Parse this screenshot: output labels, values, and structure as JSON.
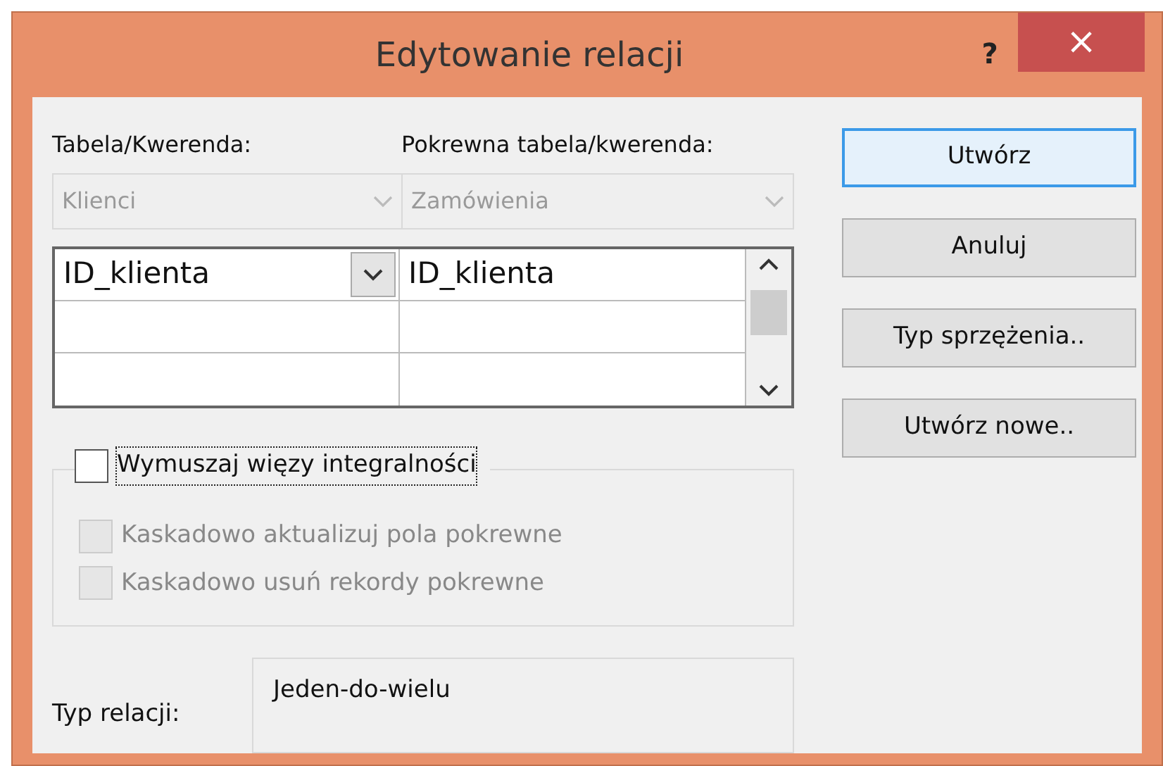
{
  "window": {
    "title": "Edytowanie relacji",
    "help": "?",
    "close": "×"
  },
  "table_label": "Tabela/Kwerenda:",
  "related_label": "Pokrewna tabela/kwerenda:",
  "table_select": {
    "value": "Klienci",
    "disabled": true
  },
  "related_select": {
    "value": "Zamówienia",
    "disabled": true
  },
  "field_rows": [
    {
      "column_1": "ID_klienta",
      "column_2": "ID_klienta"
    }
  ],
  "checkboxes": [
    {
      "label": "Wymuszaj więzy integralności",
      "checked": false,
      "disabled": false,
      "focused": true
    },
    {
      "label": "Kaskadowo aktualizuj pola pokrewne",
      "checked": false,
      "disabled": true,
      "focused": false
    },
    {
      "label": "Kaskadowo usuń rekordy pokrewne",
      "checked": false,
      "disabled": true,
      "focused": false
    }
  ],
  "relation_type": {
    "label": "Typ relacji:",
    "value": "Jeden-do-wielu"
  },
  "buttons": [
    {
      "label": "Utwórz",
      "default": true
    },
    {
      "label": "Anuluj",
      "default": false
    },
    {
      "label": "Typ sprzężenia..",
      "default": false
    },
    {
      "label": "Utwórz nowe..",
      "default": false
    }
  ]
}
